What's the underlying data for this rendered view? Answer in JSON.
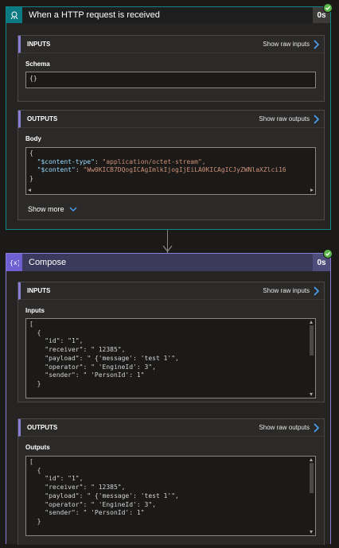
{
  "trigger": {
    "title": "When a HTTP request is received",
    "duration": "0s",
    "inputs": {
      "section_title": "INPUTS",
      "raw_link": "Show raw inputs",
      "schema_label": "Schema",
      "schema_value": "{}"
    },
    "outputs": {
      "section_title": "OUTPUTS",
      "raw_link": "Show raw outputs",
      "body_label": "Body",
      "body_lines": {
        "l1": "{",
        "l2_key": "\"$content-type\"",
        "l2_val": "\"application/octet-stream\",",
        "l3_key": "\"$content\"",
        "l3_val": "\"Ww0KICB7DQogICAgImlkIjogIjEiLA0KICAgICJyZWNlaXZlci16",
        "l4": "}"
      }
    },
    "show_more": "Show more"
  },
  "compose": {
    "title": "Compose",
    "duration": "0s",
    "inputs": {
      "section_title": "INPUTS",
      "raw_link": "Show raw inputs",
      "field_label": "Inputs",
      "lines": {
        "l1": "[",
        "l2": "  {",
        "l3_key": "\"id\"",
        "l3_val": "\"1\",",
        "l4_key": "\"receiver\"",
        "l4_val": "\" 12385\",",
        "l5_key": "\"payload\"",
        "l5_val": "\" {'message': 'test 1'\",",
        "l6_key": "\"operator\"",
        "l6_val": "\" 'EngineId': 3\",",
        "l7_key": "\"sender\"",
        "l7_val": "\" 'PersonId': 1\"",
        "l8": "  }"
      }
    },
    "outputs": {
      "section_title": "OUTPUTS",
      "raw_link": "Show raw outputs",
      "field_label": "Outputs",
      "lines": {
        "l1": "[",
        "l2": "  {",
        "l3_key": "\"id\"",
        "l3_val": "\"1\",",
        "l4_key": "\"receiver\"",
        "l4_val": "\" 12385\",",
        "l5_key": "\"payload\"",
        "l5_val": "\" {'message': 'test 1'\",",
        "l6_key": "\"operator\"",
        "l6_val": "\" 'EngineId': 3\",",
        "l7_key": "\"sender\"",
        "l7_val": "\" 'PersonId': 1\"",
        "l8": "  }"
      }
    }
  },
  "colors": {
    "trigger_accent": "#0f868a",
    "compose_accent": "#6f5fd1",
    "success": "#5bbb4a",
    "link_arrow": "#4fa3f7"
  }
}
